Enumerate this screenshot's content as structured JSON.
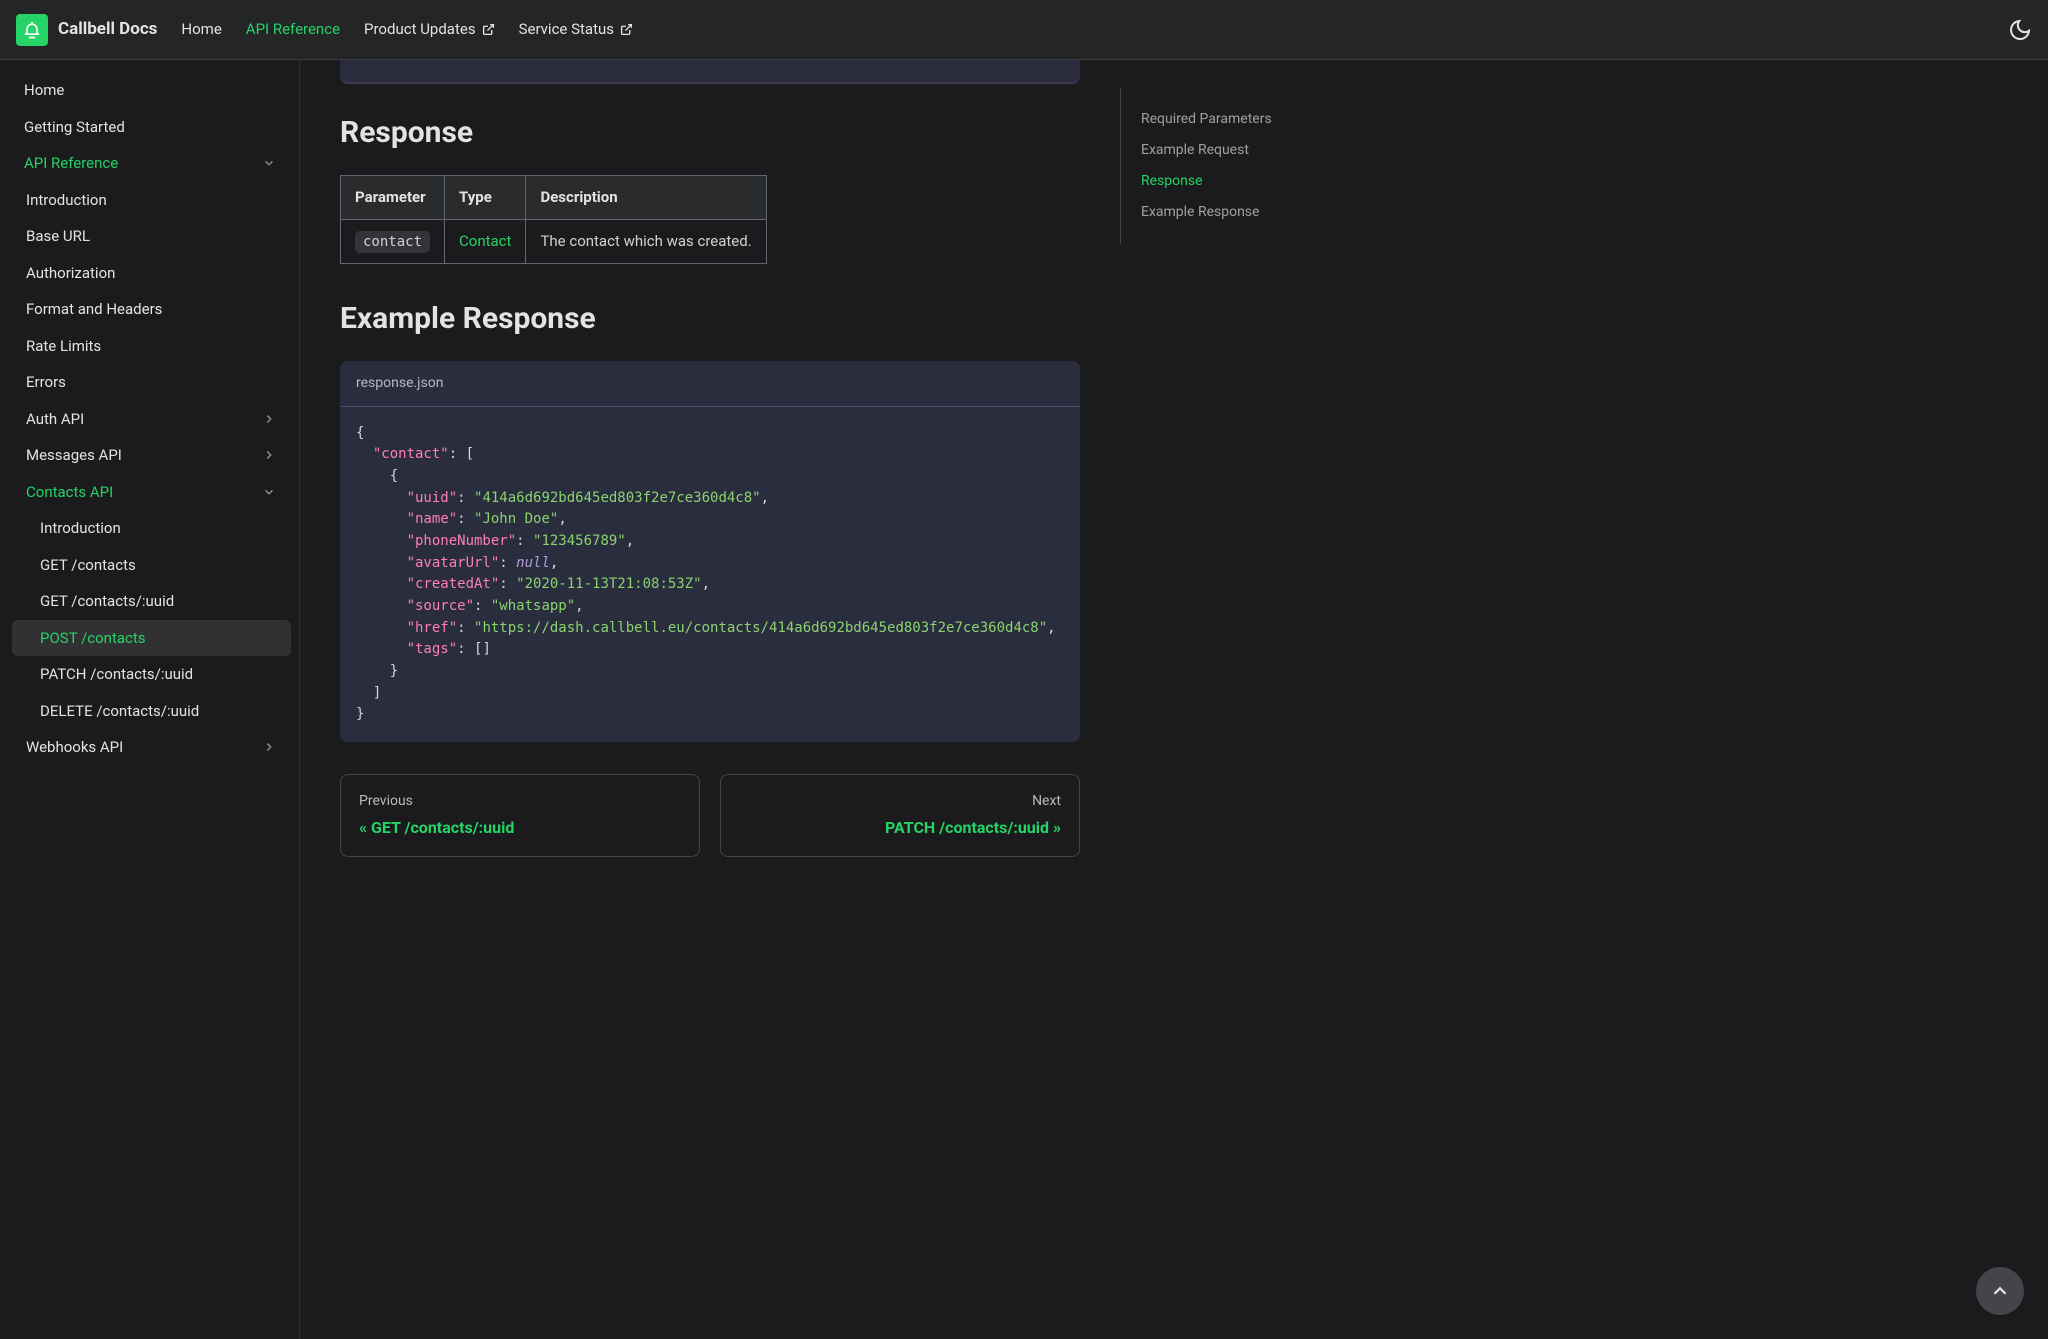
{
  "navbar": {
    "brand": "Callbell Docs",
    "links": {
      "home": "Home",
      "api_reference": "API Reference",
      "product_updates": "Product Updates",
      "service_status": "Service Status"
    }
  },
  "sidebar": {
    "home": "Home",
    "getting_started": "Getting Started",
    "api_reference": "API Reference",
    "introduction": "Introduction",
    "base_url": "Base URL",
    "authorization": "Authorization",
    "format_headers": "Format and Headers",
    "rate_limits": "Rate Limits",
    "errors": "Errors",
    "auth_api": "Auth API",
    "messages_api": "Messages API",
    "contacts_api": "Contacts API",
    "contacts_intro": "Introduction",
    "get_contacts": "GET /contacts",
    "get_contacts_uuid": "GET /contacts/:uuid",
    "post_contacts": "POST /contacts",
    "patch_contacts_uuid": "PATCH /contacts/:uuid",
    "delete_contacts_uuid": "DELETE /contacts/:uuid",
    "webhooks_api": "Webhooks API"
  },
  "main": {
    "response_heading": "Response",
    "table": {
      "h_parameter": "Parameter",
      "h_type": "Type",
      "h_description": "Description",
      "r_param": "contact",
      "r_type": "Contact",
      "r_desc": "The contact which was created."
    },
    "example_response_heading": "Example Response",
    "code_filename": "response.json",
    "code": {
      "l1": "{",
      "l2a": "  ",
      "l2b": "\"contact\"",
      "l2c": ": [",
      "l3": "    {",
      "l4a": "      ",
      "l4b": "\"uuid\"",
      "l4c": ": ",
      "l4d": "\"414a6d692bd645ed803f2e7ce360d4c8\"",
      "l4e": ",",
      "l5a": "      ",
      "l5b": "\"name\"",
      "l5c": ": ",
      "l5d": "\"John Doe\"",
      "l5e": ",",
      "l6a": "      ",
      "l6b": "\"phoneNumber\"",
      "l6c": ": ",
      "l6d": "\"123456789\"",
      "l6e": ",",
      "l7a": "      ",
      "l7b": "\"avatarUrl\"",
      "l7c": ": ",
      "l7d": "null",
      "l7e": ",",
      "l8a": "      ",
      "l8b": "\"createdAt\"",
      "l8c": ": ",
      "l8d": "\"2020-11-13T21:08:53Z\"",
      "l8e": ",",
      "l9a": "      ",
      "l9b": "\"source\"",
      "l9c": ": ",
      "l9d": "\"whatsapp\"",
      "l9e": ",",
      "l10a": "      ",
      "l10b": "\"href\"",
      "l10c": ": ",
      "l10d": "\"https://dash.callbell.eu/contacts/414a6d692bd645ed803f2e7ce360d4c8\"",
      "l10e": ",",
      "l11a": "      ",
      "l11b": "\"tags\"",
      "l11c": ": []",
      "l12": "    }",
      "l13": "  ]",
      "l14": "}"
    }
  },
  "pagination": {
    "prev_label": "Previous",
    "prev_title": "« GET /contacts/:uuid",
    "next_label": "Next",
    "next_title": "PATCH /contacts/:uuid »"
  },
  "toc": {
    "required_params": "Required Parameters",
    "example_request": "Example Request",
    "response": "Response",
    "example_response": "Example Response"
  }
}
